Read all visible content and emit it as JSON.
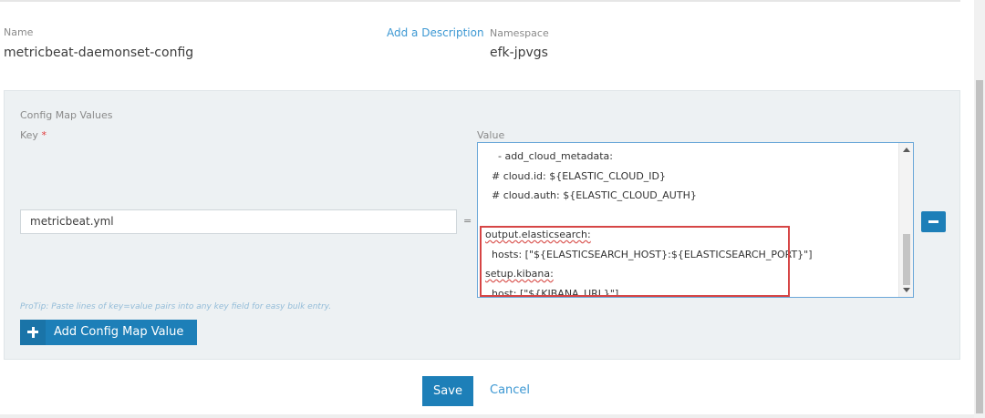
{
  "header": {
    "name_label": "Name",
    "name_value": "metricbeat-daemonset-config",
    "add_description": "Add a Description",
    "namespace_label": "Namespace",
    "namespace_value": "efk-jpvgs"
  },
  "config_map": {
    "title": "Config Map Values",
    "key_label": "Key",
    "required_mark": "*",
    "value_label": "Value",
    "key_value": "metricbeat.yml",
    "equals": "=",
    "value_lines": [
      "    - add_cloud_metadata:",
      "  # cloud.id: ${ELASTIC_CLOUD_ID}",
      "  # cloud.auth: ${ELASTIC_CLOUD_AUTH}",
      "",
      "output.elasticsearch:",
      "  hosts: [\"${ELASTICSEARCH_HOST}:${ELASTICSEARCH_PORT}\"]",
      "setup.kibana:",
      "  host: [\"${KIBANA_URL}\"]"
    ],
    "protip": "ProTip: Paste lines of key=value pairs into any key field for easy bulk entry.",
    "add_button_label": "Add Config Map Value"
  },
  "actions": {
    "save_label": "Save",
    "cancel_label": "Cancel"
  },
  "colors": {
    "accent": "#1d7fb8",
    "link": "#3d98d3",
    "highlight": "#d64545",
    "panel_bg": "#edf1f3"
  },
  "icons": {
    "remove": "minus-icon",
    "add": "plus-icon"
  }
}
